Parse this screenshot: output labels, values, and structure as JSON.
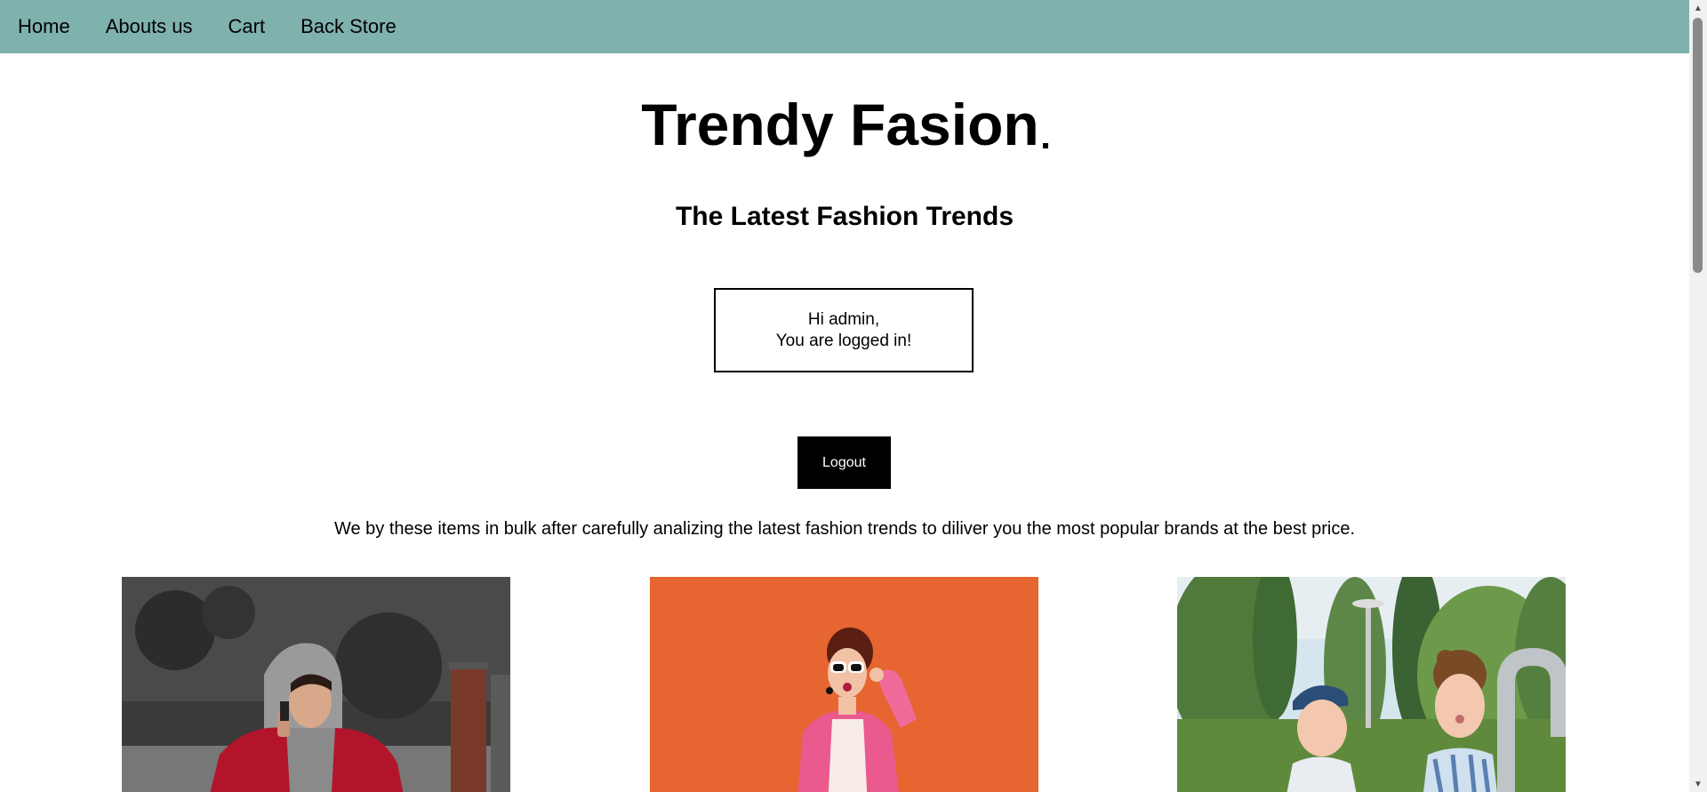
{
  "nav": {
    "items": [
      {
        "label": "Home"
      },
      {
        "label": "Abouts us"
      },
      {
        "label": "Cart"
      },
      {
        "label": "Back Store"
      }
    ]
  },
  "header": {
    "title": "Trendy Fasion",
    "subtitle": "The Latest Fashion Trends"
  },
  "greeting": {
    "line1": "Hi admin,",
    "line2": "You are logged in!"
  },
  "logout_label": "Logout",
  "intro_text": "We by these items in bulk after carefully analizing the latest fashion trends to diliver you the most popular brands at the best price.",
  "colors": {
    "navbar": "#7fb1ad",
    "button_bg": "#000000",
    "button_text": "#ffffff"
  },
  "products": [
    {
      "image": "man-in-red-jacket-photo"
    },
    {
      "image": "woman-in-pink-blazer-photo"
    },
    {
      "image": "children-in-park-photo"
    }
  ],
  "icons": {
    "scroll_up": "arrow-up-icon",
    "scroll_down": "arrow-down-icon"
  }
}
